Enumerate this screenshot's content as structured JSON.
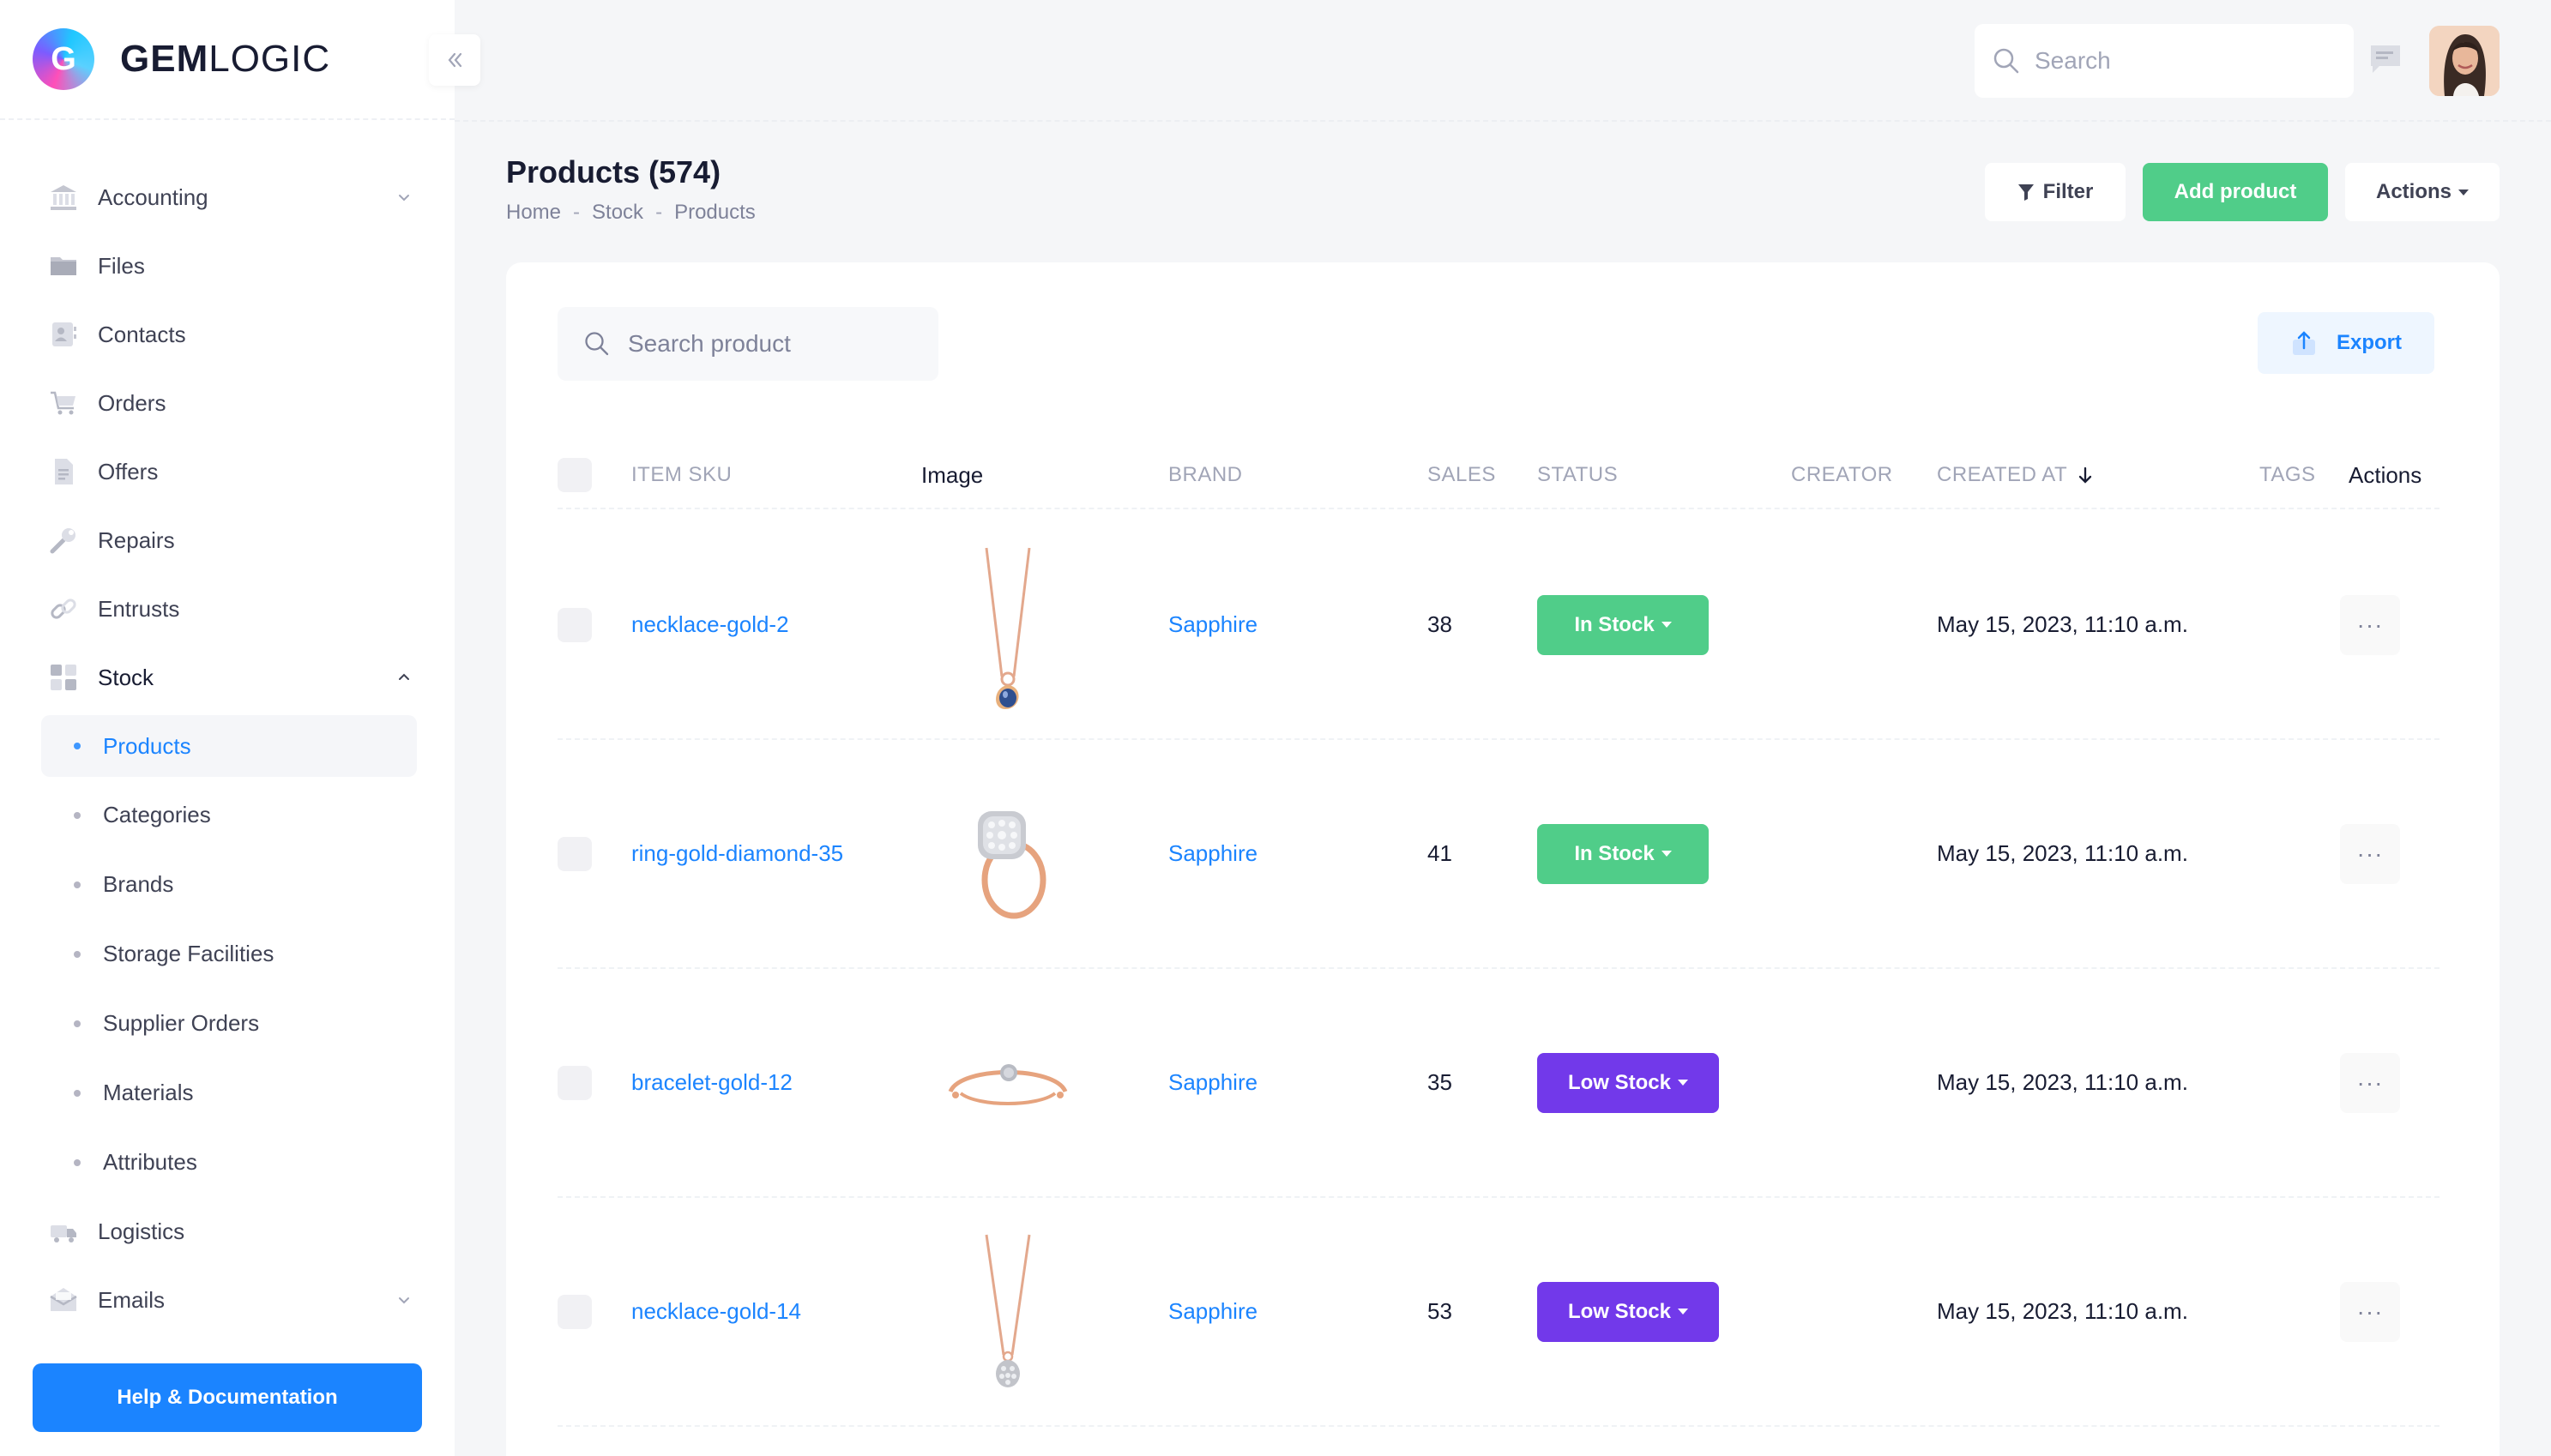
{
  "brand": {
    "logo_letter": "G",
    "name_bold": "GEM",
    "name_light": "LOGIC"
  },
  "colors": {
    "accent": "#1b84ff",
    "success": "#50cd89",
    "purple": "#7239ea"
  },
  "sidebar": {
    "items": [
      {
        "label": "Accounting",
        "icon": "bank-icon",
        "has_chevron": true
      },
      {
        "label": "Files",
        "icon": "folder-icon"
      },
      {
        "label": "Contacts",
        "icon": "contacts-icon"
      },
      {
        "label": "Orders",
        "icon": "cart-icon"
      },
      {
        "label": "Offers",
        "icon": "document-icon"
      },
      {
        "label": "Repairs",
        "icon": "wrench-icon"
      },
      {
        "label": "Entrusts",
        "icon": "link-icon"
      },
      {
        "label": "Stock",
        "icon": "grid-icon",
        "expanded": true
      }
    ],
    "stock_children": [
      {
        "label": "Products",
        "active": true
      },
      {
        "label": "Categories"
      },
      {
        "label": "Brands"
      },
      {
        "label": "Storage Facilities"
      },
      {
        "label": "Supplier Orders"
      },
      {
        "label": "Materials"
      },
      {
        "label": "Attributes"
      }
    ],
    "bottom_items": [
      {
        "label": "Logistics",
        "icon": "truck-icon"
      },
      {
        "label": "Emails",
        "icon": "mail-icon",
        "has_chevron": true
      }
    ],
    "help_label": "Help & Documentation"
  },
  "topbar": {
    "search_placeholder": "Search"
  },
  "page": {
    "title": "Products (574)",
    "breadcrumb": [
      "Home",
      "Stock",
      "Products"
    ],
    "filter_label": "Filter",
    "add_label": "Add product",
    "actions_label": "Actions"
  },
  "table": {
    "search_placeholder": "Search product",
    "export_label": "Export",
    "headers": {
      "sku": "ITEM SKU",
      "image": "Image",
      "brand": "BRAND",
      "sales": "SALES",
      "status": "STATUS",
      "creator": "CREATOR",
      "created_at": "CREATED AT",
      "tags": "TAGS",
      "actions": "Actions"
    },
    "rows": [
      {
        "sku": "necklace-gold-2",
        "image": "necklace-blue-pendant",
        "brand": "Sapphire",
        "sales": "38",
        "status": "In Stock",
        "status_kind": "in",
        "created_at": "May 15, 2023, 11:10 a.m.",
        "more": "···"
      },
      {
        "sku": "ring-gold-diamond-35",
        "image": "ring-diamond",
        "brand": "Sapphire",
        "sales": "41",
        "status": "In Stock",
        "status_kind": "in",
        "created_at": "May 15, 2023, 11:10 a.m.",
        "more": "···"
      },
      {
        "sku": "bracelet-gold-12",
        "image": "bracelet-gold",
        "brand": "Sapphire",
        "sales": "35",
        "status": "Low Stock",
        "status_kind": "low",
        "created_at": "May 15, 2023, 11:10 a.m.",
        "more": "···"
      },
      {
        "sku": "necklace-gold-14",
        "image": "necklace-diamond-pendant",
        "brand": "Sapphire",
        "sales": "53",
        "status": "Low Stock",
        "status_kind": "low",
        "created_at": "May 15, 2023, 11:10 a.m.",
        "more": "···"
      }
    ]
  }
}
